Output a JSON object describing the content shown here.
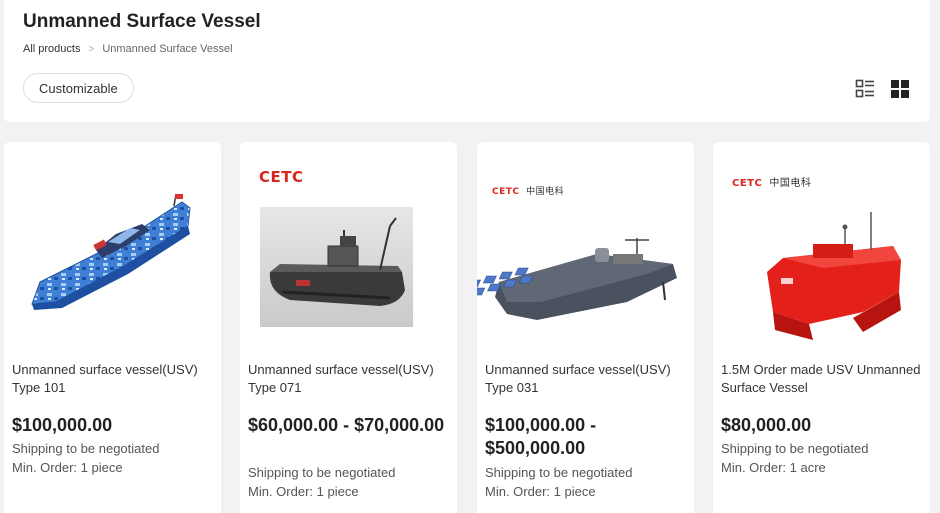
{
  "header": {
    "title": "Unmanned Surface Vessel",
    "breadcrumb": [
      "All products",
      "Unmanned Surface Vessel"
    ],
    "filter_chip": "Customizable",
    "views": [
      "list-view-icon",
      "grid-view-icon"
    ]
  },
  "brand": {
    "name": "CETC",
    "name_cn": "中国电科"
  },
  "products": [
    {
      "title": "Unmanned surface vessel(USV) Type 101",
      "price": "$100,000.00",
      "shipping": "Shipping to be negotiated",
      "min_order": "Min. Order: 1 piece"
    },
    {
      "title": "Unmanned surface vessel(USV) Type 071",
      "price": "$60,000.00 - $70,000.00",
      "shipping": "Shipping to be negotiated",
      "min_order": "Min. Order: 1 piece"
    },
    {
      "title": "Unmanned surface vessel(USV) Type 031",
      "price": "$100,000.00 - $500,000.00",
      "shipping": "Shipping to be negotiated",
      "min_order": "Min. Order: 1 piece"
    },
    {
      "title": "1.5M Order made USV Unmanned Surface Vessel",
      "price": "$80,000.00",
      "shipping": "Shipping to be negotiated",
      "min_order": "Min. Order: 1 acre"
    }
  ],
  "colors": {
    "brand_red": "#d9261c",
    "page_bg": "#f2f2f4",
    "card_bg": "#ffffff"
  }
}
